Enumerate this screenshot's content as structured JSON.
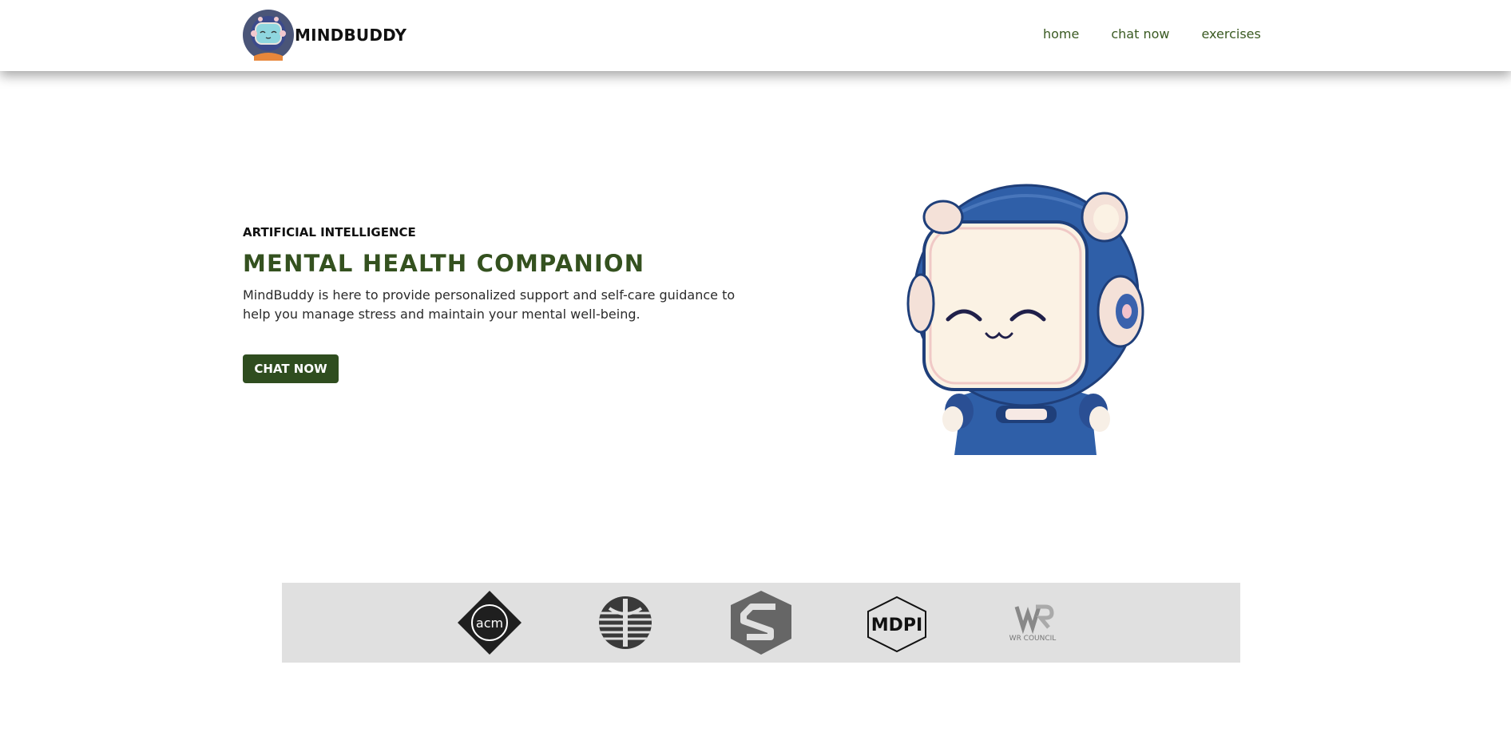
{
  "header": {
    "brand_name": "MINDBUDDY",
    "logo_icon": "robot-avatar-icon",
    "nav": [
      {
        "label": "home"
      },
      {
        "label": "chat now"
      },
      {
        "label": "exercises"
      }
    ]
  },
  "hero": {
    "eyebrow": "ARTIFICIAL INTELLIGENCE",
    "headline": "MENTAL HEALTH COMPANION",
    "description": "MindBuddy is here to provide personalized support and self-care guidance to help you manage stress and maintain your mental well-being.",
    "cta_label": "CHAT NOW",
    "illustration": "smiling-robot-mascot"
  },
  "partners": {
    "logos": [
      {
        "icon": "acm-logo-icon",
        "text": "acm"
      },
      {
        "icon": "striped-circle-logo-icon"
      },
      {
        "icon": "s-hexagon-logo-icon"
      },
      {
        "icon": "mdpi-logo-icon",
        "text": "MDPI"
      },
      {
        "icon": "wr-council-logo-icon",
        "text": "WR COUNCIL"
      }
    ]
  },
  "colors": {
    "nav_link": "#3a5a22",
    "headline": "#34511f",
    "cta_background": "#2f4d1f",
    "partners_background": "#e0e0e0"
  }
}
